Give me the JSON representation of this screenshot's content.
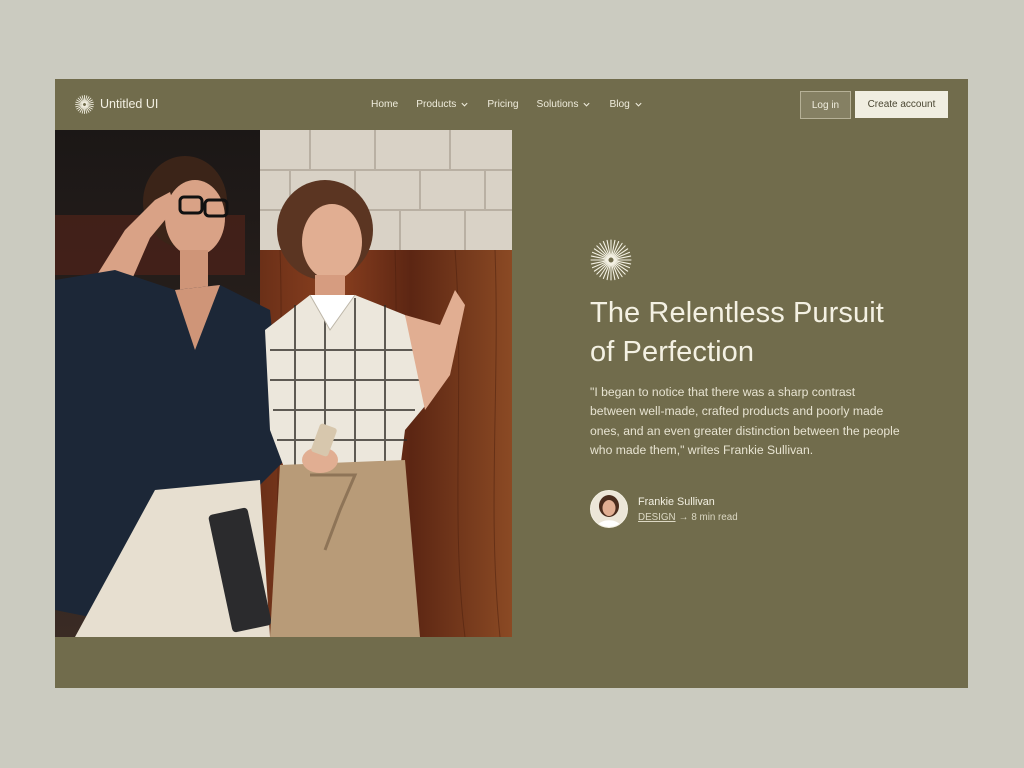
{
  "brand": {
    "name": "Untitled UI",
    "logo_icon": "sunburst-logo-icon"
  },
  "nav": {
    "items": [
      {
        "label": "Home",
        "has_dropdown": false
      },
      {
        "label": "Products",
        "has_dropdown": true
      },
      {
        "label": "Pricing",
        "has_dropdown": false
      },
      {
        "label": "Solutions",
        "has_dropdown": true
      },
      {
        "label": "Blog",
        "has_dropdown": true
      }
    ],
    "login_label": "Log in",
    "create_account_label": "Create account"
  },
  "hero": {
    "title": "The Relentless Pursuit of Perfection",
    "quote": "\"I began to notice that there was a sharp contrast between well-made, crafted products and poorly made ones, and an even greater distinction between the people who made them,\" writes Frankie Sullivan.",
    "author": {
      "name": "Frankie Sullivan",
      "category": "DESIGN",
      "separator": "→",
      "read_time": "8 min read"
    }
  },
  "colors": {
    "page_bg": "#cbcbc0",
    "panel_bg": "#716c4c",
    "text_light": "#f4f1e3",
    "button_light": "#f0eee1"
  }
}
